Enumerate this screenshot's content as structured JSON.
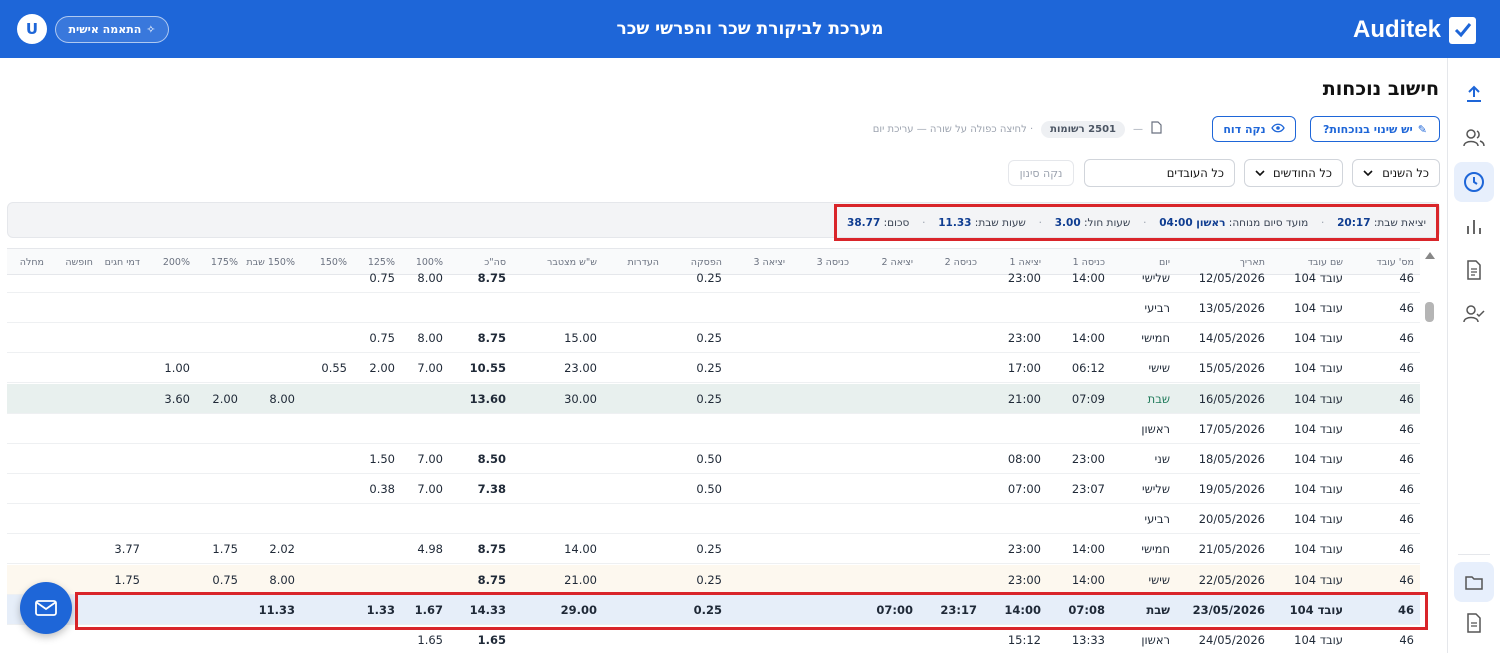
{
  "header": {
    "brand": "Auditek",
    "title": "מערכת לביקורת שכר והפרשי שכר",
    "personal_button": "התאמה אישית",
    "avatar_letter": "U",
    "color": "#1e66d8"
  },
  "page": {
    "title": "חישוב נוכחות",
    "changes_button": "יש שינוי בנוכחות?",
    "clear_report_button": "נקה דוח",
    "records": "2501 רשומות",
    "dash": "—",
    "hint": "· לחיצה כפולה על שורה — עריכת יום"
  },
  "filters": {
    "years": "כל השנים",
    "months": "כל החודשים",
    "employees": "כל העובדים",
    "clear_filter": "נקה סינון"
  },
  "summary": {
    "shabbat_exit_label": "יציאת שבת:",
    "shabbat_exit_value": "20:17",
    "rest_end_label": "מועד סיום מנוחה:",
    "rest_end_value": "ראשון 04:00",
    "weekday_hours_label": "שעות חול:",
    "weekday_hours_value": "3.00",
    "shabbat_hours_label": "שעות שבת:",
    "shabbat_hours_value": "11.33",
    "total_label": "סכום:",
    "total_value": "38.77"
  },
  "table": {
    "columns": {
      "emp_no": "מס' עובד",
      "name": "שם עובד",
      "date": "תאריך",
      "day": "יום",
      "in1": "כניסה 1",
      "out1": "יציאה 1",
      "in2": "כניסה 2",
      "out2": "יציאה 2",
      "in3": "כניסה 3",
      "out3": "יציאה 3",
      "break": "הפסקה",
      "absences": "העדרות",
      "cumulative": "ש\"ש מצטבר",
      "total": "סה\"כ",
      "p100": "100%",
      "p125": "125%",
      "p150": "150%",
      "p150s": "150% שבת",
      "p175": "175%",
      "p200": "200%",
      "holiday_pay": "דמי חגים",
      "vacation": "חופשה",
      "sick": "מחלה"
    },
    "rows": [
      {
        "emp_no": "46",
        "name": "עובד 104",
        "date": "12/05/2026",
        "day": "שלישי",
        "in1": "14:00",
        "out1": "23:00",
        "in2": "",
        "out2": "",
        "break": "0.25",
        "cumulative": "",
        "total": "8.75",
        "p100": "8.00",
        "p125": "0.75",
        "p150": "",
        "p150s": "",
        "p175": "",
        "p200": "",
        "holiday_pay": ""
      },
      {
        "emp_no": "46",
        "name": "עובד 104",
        "date": "13/05/2026",
        "day": "רביעי",
        "in1": "",
        "out1": "",
        "in2": "",
        "out2": "",
        "break": "",
        "cumulative": "",
        "total": "",
        "p100": "",
        "p125": "",
        "p150": "",
        "p150s": "",
        "p175": "",
        "p200": "",
        "holiday_pay": ""
      },
      {
        "emp_no": "46",
        "name": "עובד 104",
        "date": "14/05/2026",
        "day": "חמישי",
        "in1": "14:00",
        "out1": "23:00",
        "in2": "",
        "out2": "",
        "break": "0.25",
        "cumulative": "15.00",
        "total": "8.75",
        "p100": "8.00",
        "p125": "0.75",
        "p150": "",
        "p150s": "",
        "p175": "",
        "p200": "",
        "holiday_pay": ""
      },
      {
        "emp_no": "46",
        "name": "עובד 104",
        "date": "15/05/2026",
        "day": "שישי",
        "in1": "06:12",
        "out1": "17:00",
        "in2": "",
        "out2": "",
        "break": "0.25",
        "cumulative": "23.00",
        "total": "10.55",
        "p100": "7.00",
        "p125": "2.00",
        "p150": "0.55",
        "p150s": "",
        "p175": "",
        "p200": "1.00",
        "holiday_pay": ""
      },
      {
        "emp_no": "46",
        "name": "עובד 104",
        "date": "16/05/2026",
        "day": "שבת",
        "in1": "07:09",
        "out1": "21:00",
        "in2": "",
        "out2": "",
        "break": "0.25",
        "cumulative": "30.00",
        "total": "13.60",
        "p100": "",
        "p125": "",
        "p150": "",
        "p150s": "8.00",
        "p175": "2.00",
        "p200": "3.60",
        "holiday_pay": ""
      },
      {
        "emp_no": "46",
        "name": "עובד 104",
        "date": "17/05/2026",
        "day": "ראשון",
        "in1": "",
        "out1": "",
        "in2": "",
        "out2": "",
        "break": "",
        "cumulative": "",
        "total": "",
        "p100": "",
        "p125": "",
        "p150": "",
        "p150s": "",
        "p175": "",
        "p200": "",
        "holiday_pay": ""
      },
      {
        "emp_no": "46",
        "name": "עובד 104",
        "date": "18/05/2026",
        "day": "שני",
        "in1": "23:00",
        "out1": "08:00",
        "in2": "",
        "out2": "",
        "break": "0.50",
        "cumulative": "",
        "total": "8.50",
        "p100": "7.00",
        "p125": "1.50",
        "p150": "",
        "p150s": "",
        "p175": "",
        "p200": "",
        "holiday_pay": ""
      },
      {
        "emp_no": "46",
        "name": "עובד 104",
        "date": "19/05/2026",
        "day": "שלישי",
        "in1": "23:07",
        "out1": "07:00",
        "in2": "",
        "out2": "",
        "break": "0.50",
        "cumulative": "",
        "total": "7.38",
        "p100": "7.00",
        "p125": "0.38",
        "p150": "",
        "p150s": "",
        "p175": "",
        "p200": "",
        "holiday_pay": ""
      },
      {
        "emp_no": "46",
        "name": "עובד 104",
        "date": "20/05/2026",
        "day": "רביעי",
        "in1": "",
        "out1": "",
        "in2": "",
        "out2": "",
        "break": "",
        "cumulative": "",
        "total": "",
        "p100": "",
        "p125": "",
        "p150": "",
        "p150s": "",
        "p175": "",
        "p200": "",
        "holiday_pay": ""
      },
      {
        "emp_no": "46",
        "name": "עובד 104",
        "date": "21/05/2026",
        "day": "חמישי",
        "in1": "14:00",
        "out1": "23:00",
        "in2": "",
        "out2": "",
        "break": "0.25",
        "cumulative": "14.00",
        "total": "8.75",
        "p100": "4.98",
        "p125": "",
        "p150": "",
        "p150s": "2.02",
        "p175": "1.75",
        "p200": "",
        "holiday_pay": "3.77"
      },
      {
        "emp_no": "46",
        "name": "עובד 104",
        "date": "22/05/2026",
        "day": "שישי",
        "in1": "14:00",
        "out1": "23:00",
        "in2": "",
        "out2": "",
        "break": "0.25",
        "cumulative": "21.00",
        "total": "8.75",
        "p100": "",
        "p125": "",
        "p150": "",
        "p150s": "8.00",
        "p175": "0.75",
        "p200": "",
        "holiday_pay": "1.75"
      },
      {
        "emp_no": "46",
        "name": "עובד 104",
        "date": "23/05/2026",
        "day": "שבת",
        "in1": "07:08",
        "out1": "14:00",
        "in2": "23:17",
        "out2": "07:00",
        "break": "0.25",
        "cumulative": "29.00",
        "total": "14.33",
        "p100": "1.67",
        "p125": "1.33",
        "p150": "",
        "p150s": "11.33",
        "p175": "",
        "p200": "",
        "holiday_pay": ""
      },
      {
        "emp_no": "46",
        "name": "עובד 104",
        "date": "24/05/2026",
        "day": "ראשון",
        "in1": "13:33",
        "out1": "15:12",
        "in2": "",
        "out2": "",
        "break": "",
        "cumulative": "",
        "total": "1.65",
        "p100": "1.65",
        "p125": "",
        "p150": "",
        "p150s": "",
        "p175": "",
        "p200": "",
        "holiday_pay": ""
      }
    ]
  }
}
